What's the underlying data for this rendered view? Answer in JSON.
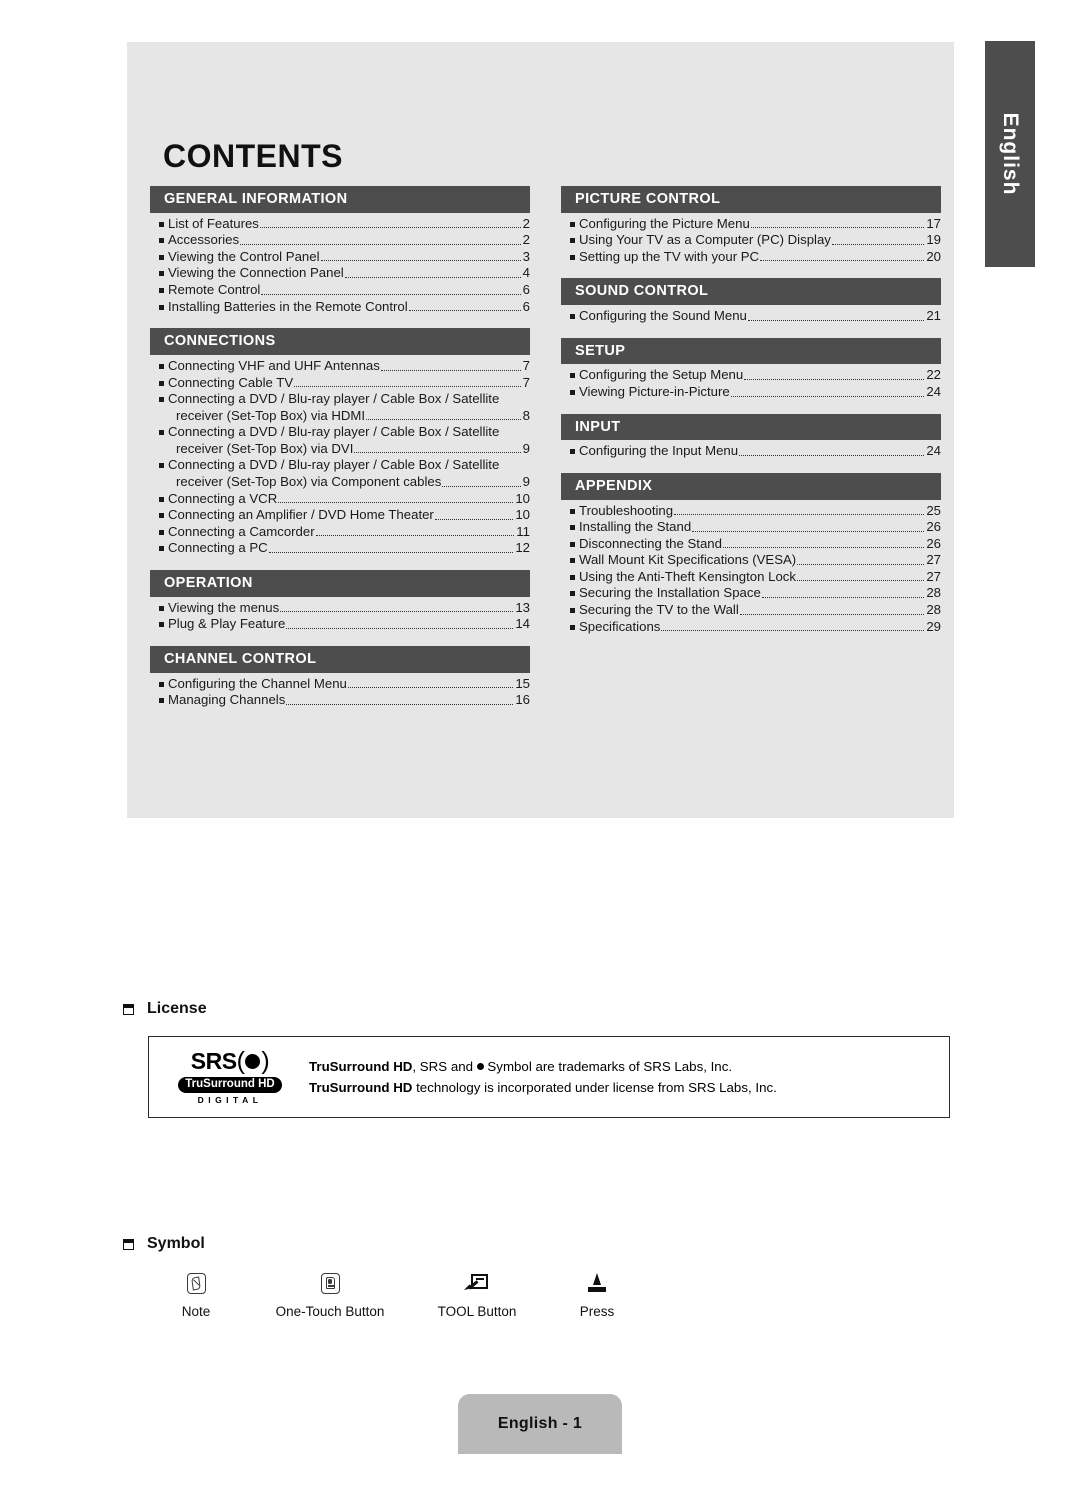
{
  "page": {
    "title": "CONTENTS",
    "language_tab": "English",
    "footer": "English - 1"
  },
  "toc": {
    "left_sections": [
      {
        "heading": "GENERAL INFORMATION",
        "entries": [
          {
            "label": "List of Features",
            "page": "2"
          },
          {
            "label": "Accessories",
            "page": "2"
          },
          {
            "label": "Viewing the Control Panel",
            "page": "3"
          },
          {
            "label": "Viewing the Connection Panel",
            "page": "4"
          },
          {
            "label": "Remote Control",
            "page": "6"
          },
          {
            "label": "Installing Batteries in the Remote Control",
            "page": "6"
          }
        ]
      },
      {
        "heading": "CONNECTIONS",
        "entries": [
          {
            "label": "Connecting VHF and UHF Antennas",
            "page": "7"
          },
          {
            "label": "Connecting Cable TV",
            "page": "7"
          },
          {
            "label": "Connecting a DVD / Blu-ray player / Cable Box / Satellite",
            "label2": "receiver (Set-Top Box) via HDMI",
            "page": "8"
          },
          {
            "label": "Connecting a DVD / Blu-ray player / Cable Box / Satellite",
            "label2": "receiver (Set-Top Box) via DVI",
            "page": "9"
          },
          {
            "label": "Connecting a DVD / Blu-ray player / Cable Box / Satellite",
            "label2": "receiver (Set-Top Box) via Component cables",
            "page": "9"
          },
          {
            "label": "Connecting a VCR",
            "page": "10"
          },
          {
            "label": "Connecting an Amplifier / DVD Home Theater",
            "page": "10"
          },
          {
            "label": "Connecting a Camcorder",
            "page": "11"
          },
          {
            "label": "Connecting a PC",
            "page": "12"
          }
        ]
      },
      {
        "heading": "OPERATION",
        "entries": [
          {
            "label": "Viewing the menus",
            "page": "13"
          },
          {
            "label": "Plug & Play Feature",
            "page": "14"
          }
        ]
      },
      {
        "heading": "CHANNEL CONTROL",
        "entries": [
          {
            "label": "Configuring the Channel Menu",
            "page": "15"
          },
          {
            "label": "Managing Channels",
            "page": "16"
          }
        ]
      }
    ],
    "right_sections": [
      {
        "heading": "PICTURE CONTROL",
        "entries": [
          {
            "label": "Configuring the Picture Menu",
            "page": "17"
          },
          {
            "label": "Using Your TV as a Computer (PC) Display",
            "page": "19"
          },
          {
            "label": "Setting up the TV with your PC",
            "page": "20"
          }
        ]
      },
      {
        "heading": "SOUND CONTROL",
        "entries": [
          {
            "label": "Configuring the Sound Menu",
            "page": "21"
          }
        ]
      },
      {
        "heading": "SETUP",
        "entries": [
          {
            "label": "Configuring the Setup Menu",
            "page": "22"
          },
          {
            "label": "Viewing Picture-in-Picture",
            "page": "24"
          }
        ]
      },
      {
        "heading": "INPUT",
        "entries": [
          {
            "label": "Configuring the Input Menu",
            "page": "24"
          }
        ]
      },
      {
        "heading": "APPENDIX",
        "entries": [
          {
            "label": "Troubleshooting",
            "page": "25"
          },
          {
            "label": "Installing the Stand",
            "page": "26"
          },
          {
            "label": "Disconnecting the Stand",
            "page": "26"
          },
          {
            "label": "Wall Mount Kit Specifications (VESA)",
            "page": "27"
          },
          {
            "label": "Using the Anti-Theft Kensington Lock",
            "page": "27"
          },
          {
            "label": "Securing the Installation Space",
            "page": "28"
          },
          {
            "label": "Securing the TV to the Wall",
            "page": "28"
          },
          {
            "label": "Specifications",
            "page": "29"
          }
        ]
      }
    ]
  },
  "license": {
    "heading": "License",
    "logo": {
      "wordmark": "SRS",
      "pill": "TruSurround HD",
      "digital": "DIGITAL"
    },
    "line1_bold": "TruSurround HD",
    "line1_rest_a": ", SRS and ",
    "line1_rest_b": " Symbol are trademarks of SRS Labs, Inc.",
    "line2_bold": "TruSurround HD",
    "line2_rest": " technology is incorporated under license from SRS Labs, Inc."
  },
  "symbol": {
    "heading": "Symbol",
    "items": [
      {
        "icon": "note-icon",
        "caption": "Note"
      },
      {
        "icon": "one-touch-button-icon",
        "caption": "One-Touch Button"
      },
      {
        "icon": "tool-button-icon",
        "caption": "TOOL Button"
      },
      {
        "icon": "press-icon",
        "caption": "Press"
      }
    ]
  },
  "colors": {
    "panel_bg": "#e6e6e6",
    "section_bar": "#4d4d4d",
    "footer_tab": "#b9b9b9"
  }
}
